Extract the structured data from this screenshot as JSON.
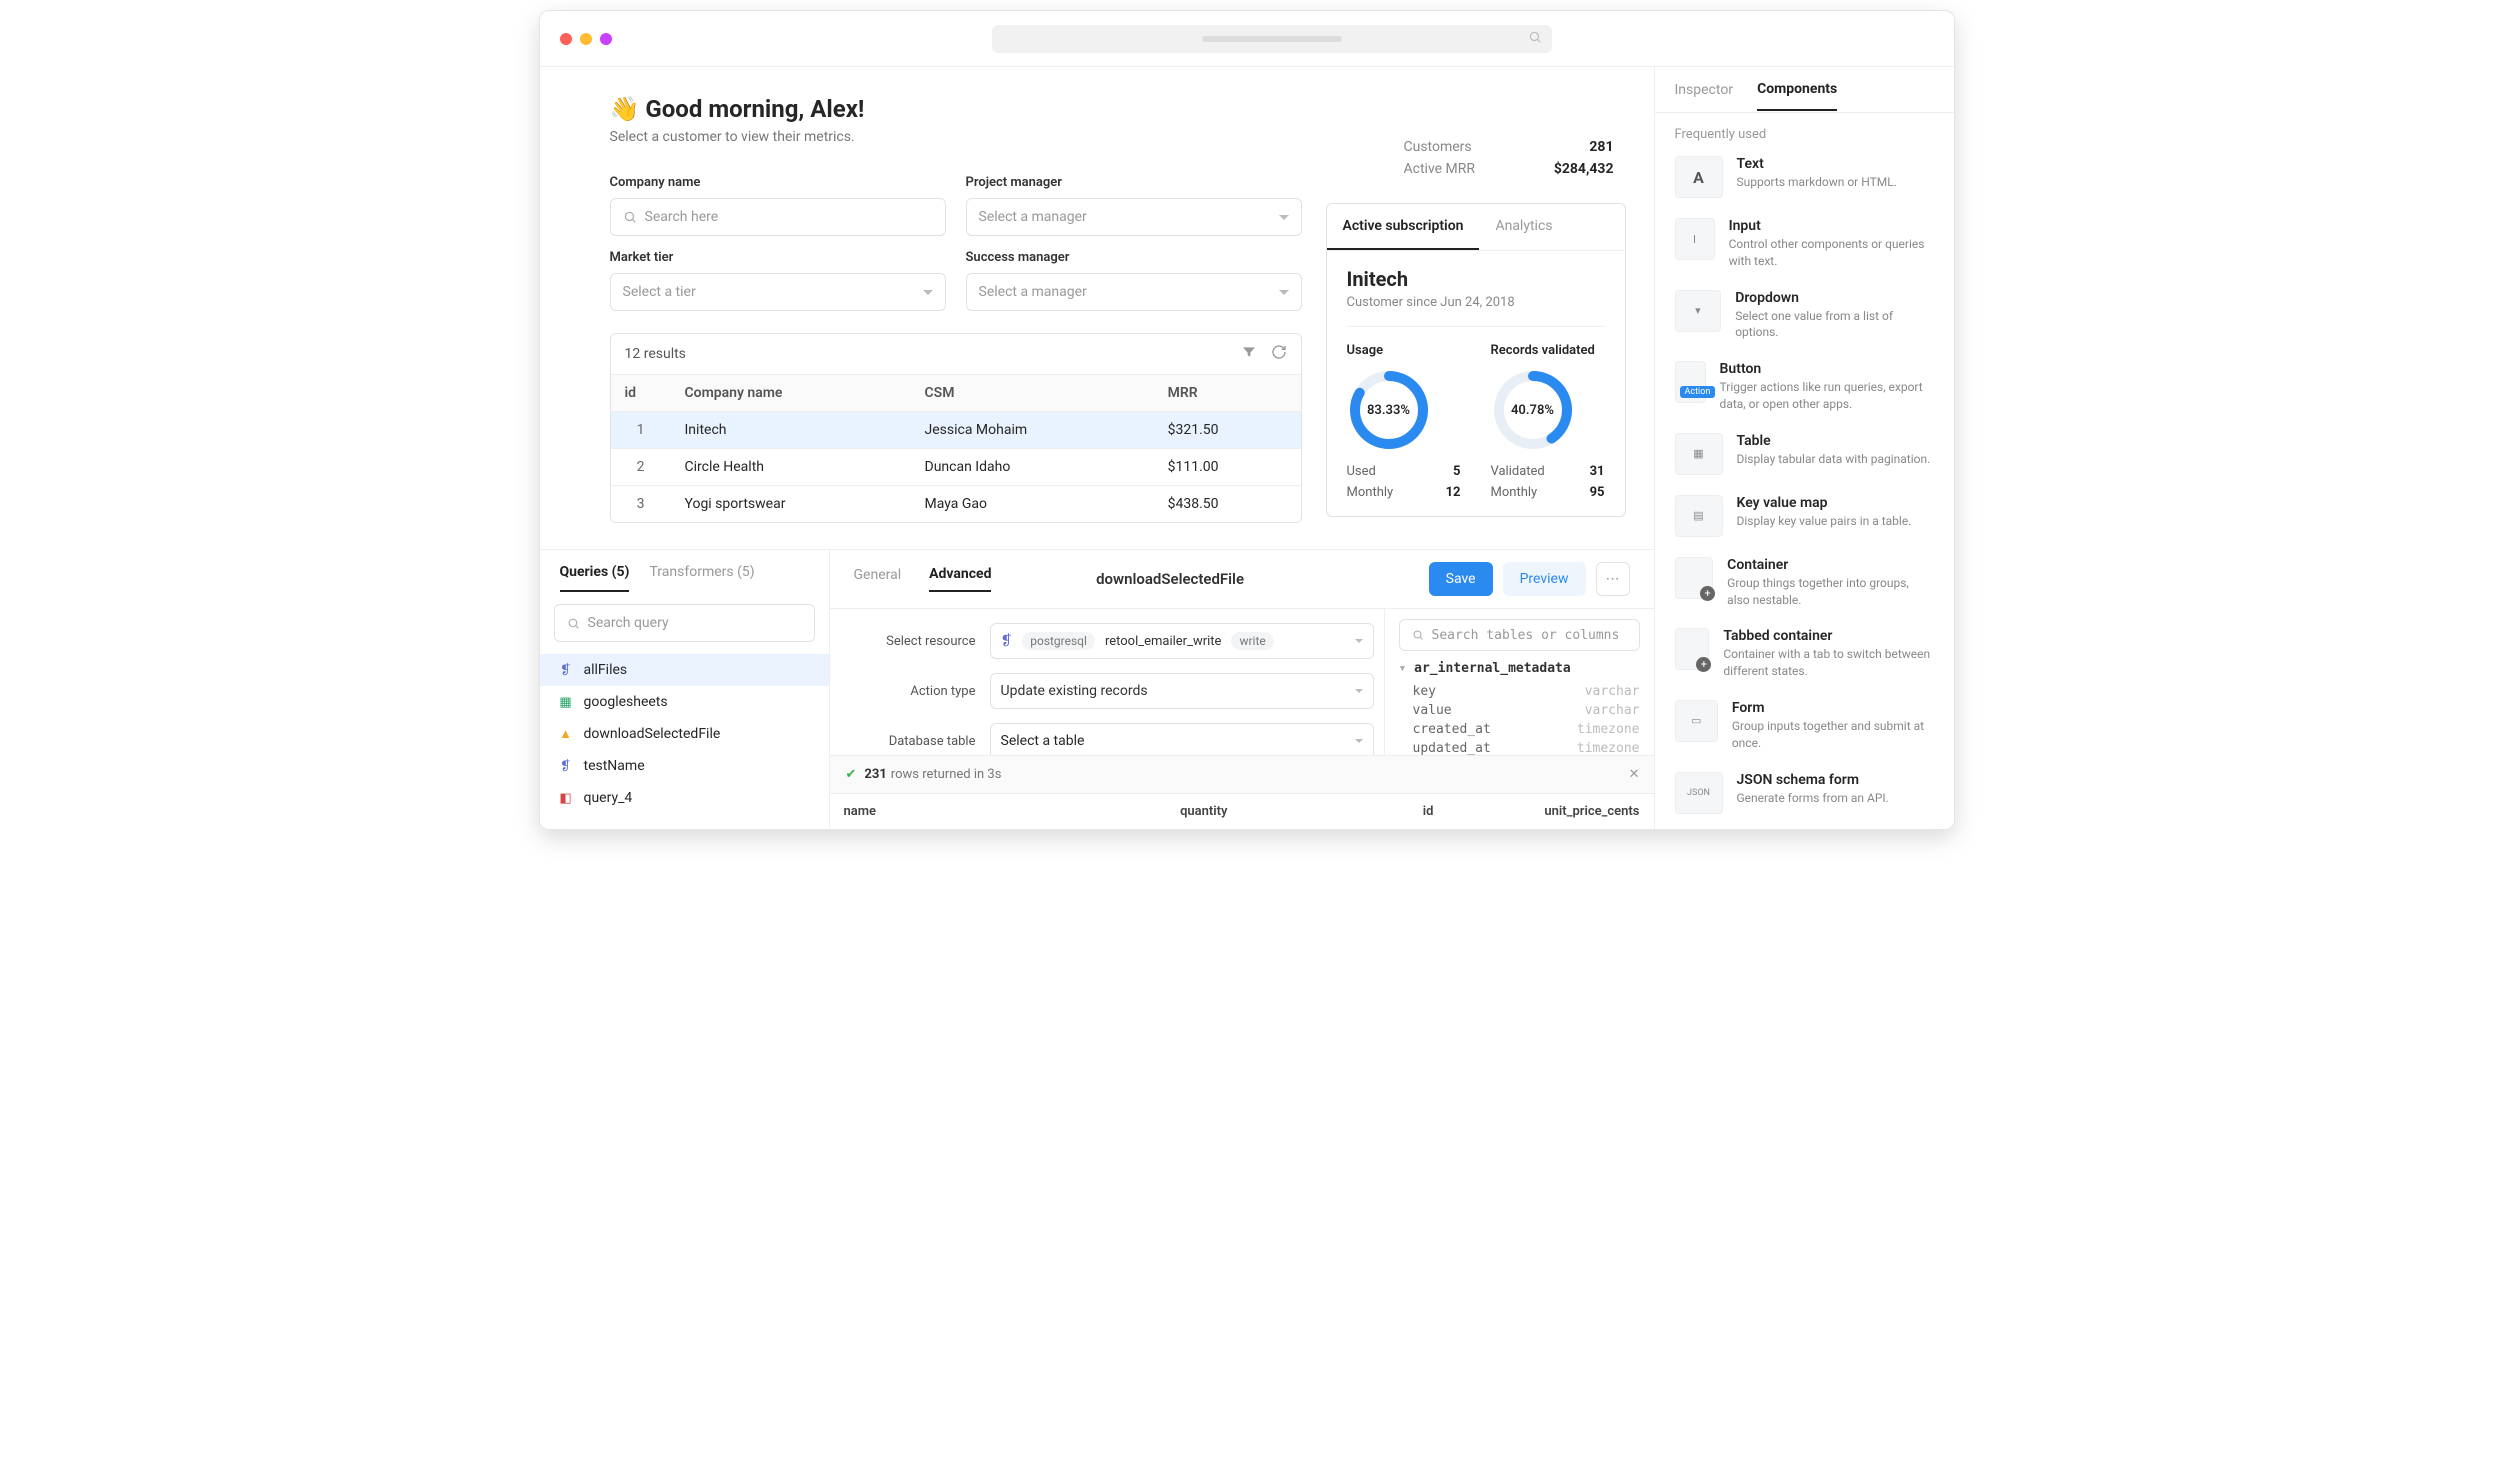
{
  "header": {
    "greeting": "Good morning, Alex!",
    "emoji": "👋",
    "subtitle": "Select a customer to view their metrics."
  },
  "kpis": {
    "customers_label": "Customers",
    "customers_value": "281",
    "mrr_label": "Active MRR",
    "mrr_value": "$284,432"
  },
  "filters": {
    "company_label": "Company name",
    "company_placeholder": "Search here",
    "pm_label": "Project manager",
    "pm_placeholder": "Select a manager",
    "tier_label": "Market tier",
    "tier_placeholder": "Select a tier",
    "sm_label": "Success manager",
    "sm_placeholder": "Select a manager"
  },
  "table": {
    "results": "12 results",
    "columns": {
      "id": "id",
      "company": "Company name",
      "csm": "CSM",
      "mrr": "MRR"
    },
    "rows": [
      {
        "id": "1",
        "company": "Initech",
        "csm": "Jessica Mohaim",
        "mrr": "$321.50"
      },
      {
        "id": "2",
        "company": "Circle Health",
        "csm": "Duncan Idaho",
        "mrr": "$111.00"
      },
      {
        "id": "3",
        "company": "Yogi sportswear",
        "csm": "Maya Gao",
        "mrr": "$438.50"
      }
    ]
  },
  "sub": {
    "tab_active": "Active subscription",
    "tab_analytics": "Analytics",
    "name": "Initech",
    "since": "Customer since Jun 24, 2018",
    "usage_label": "Usage",
    "records_label": "Records validated",
    "usage_pct": "83.33%",
    "records_pct": "40.78%",
    "used_label": "Used",
    "used_val": "5",
    "monthly_label": "Monthly",
    "monthly_u": "12",
    "validated_label": "Validated",
    "validated_val": "31",
    "monthly_r": "95"
  },
  "sidebar": {
    "tab_inspector": "Inspector",
    "tab_components": "Components",
    "frequently": "Frequently used",
    "items": [
      {
        "title": "Text",
        "desc": "Supports markdown or HTML."
      },
      {
        "title": "Input",
        "desc": "Control other components or queries with text."
      },
      {
        "title": "Dropdown",
        "desc": "Select one value from a list of options."
      },
      {
        "title": "Button",
        "desc": "Trigger actions like run queries, export data, or open other apps."
      },
      {
        "title": "Table",
        "desc": "Display tabular data with pagination."
      },
      {
        "title": "Key value map",
        "desc": "Display key value pairs in a table."
      },
      {
        "title": "Container",
        "desc": "Group things together into groups, also nestable."
      },
      {
        "title": "Tabbed container",
        "desc": "Container with a tab to switch between different states."
      },
      {
        "title": "Form",
        "desc": "Group inputs together and submit at once."
      },
      {
        "title": "JSON schema form",
        "desc": "Generate forms from an API."
      }
    ],
    "btn_badge": "Action"
  },
  "lower": {
    "queries_tab": "Queries (5)",
    "transformers_tab": "Transformers (5)",
    "search_placeholder": "Search query",
    "items": [
      {
        "name": "allFiles",
        "icon": "pg"
      },
      {
        "name": "googlesheets",
        "icon": "sheets"
      },
      {
        "name": "downloadSelectedFile",
        "icon": "fire"
      },
      {
        "name": "testName",
        "icon": "pg"
      },
      {
        "name": "query_4",
        "icon": "red"
      }
    ],
    "general_tab": "General",
    "advanced_tab": "Advanced",
    "title": "downloadSelectedFile",
    "save": "Save",
    "preview": "Preview",
    "more": "⋯",
    "resource_label": "Select resource",
    "resource_type": "postgresql",
    "resource_name": "retool_emailer_write",
    "resource_perm": "write",
    "action_label": "Action type",
    "action_value": "Update existing records",
    "dbtable_label": "Database table",
    "dbtable_placeholder": "Select a table",
    "schema_search": "Search tables or columns",
    "schema_table": "ar_internal_metadata",
    "schema_cols": [
      {
        "name": "key",
        "type": "varchar"
      },
      {
        "name": "value",
        "type": "varchar"
      },
      {
        "name": "created_at",
        "type": "timezone"
      },
      {
        "name": "updated_at",
        "type": "timezone"
      }
    ],
    "result_count": "231",
    "result_text": "rows returned in 3s",
    "rescols": {
      "name": "name",
      "quantity": "quantity",
      "id": "id",
      "unit": "unit_price_cents"
    }
  }
}
